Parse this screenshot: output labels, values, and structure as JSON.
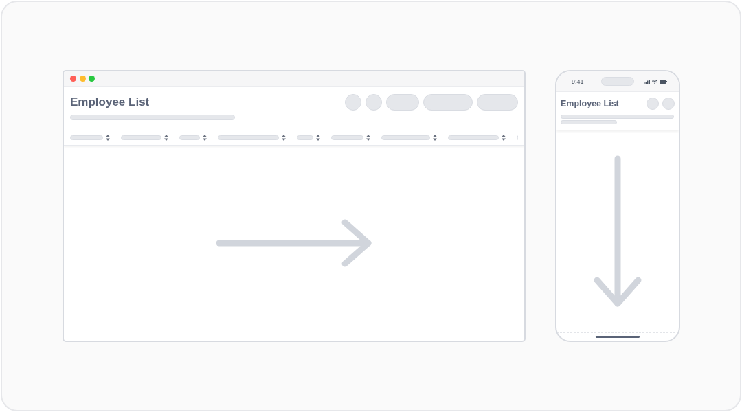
{
  "desktop_window": {
    "title": "Employee List"
  },
  "phone": {
    "status_time": "9:41",
    "title": "Employee List"
  }
}
